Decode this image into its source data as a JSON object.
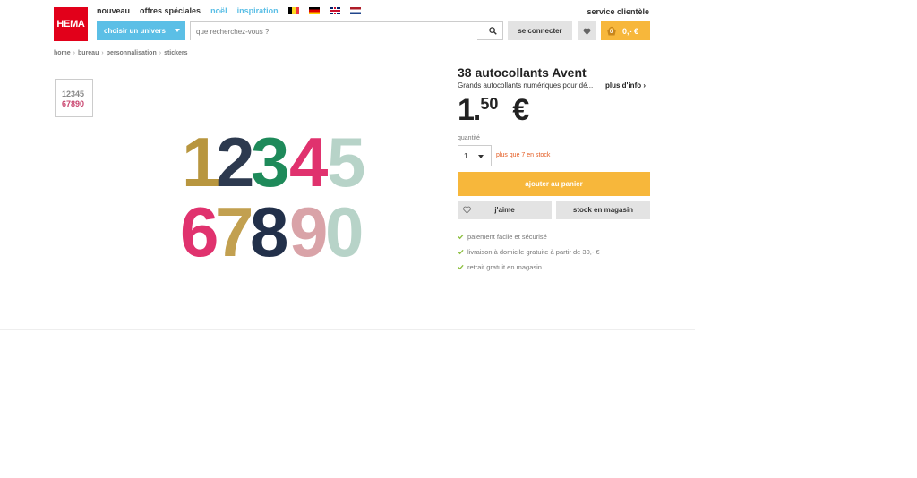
{
  "header": {
    "logo_text": "HEMA",
    "nav": [
      {
        "label": "nouveau"
      },
      {
        "label": "offres spéciales"
      },
      {
        "label": "noël"
      },
      {
        "label": "inspiration"
      }
    ],
    "service_label": "service clientèle",
    "univers_label": "choisir un univers",
    "search_placeholder": "que recherchez-vous ?",
    "connect_label": "se connecter",
    "cart_total": "0,- €",
    "cart_count": "0"
  },
  "breadcrumb": [
    "home",
    "bureau",
    "personnalisation",
    "stickers"
  ],
  "thumbnail": {
    "row1": "12345",
    "row2": "67890"
  },
  "product": {
    "title": "38 autocollants Avent",
    "description": "Grands autocollants numériques pour dé...",
    "more_info": "plus d'info",
    "price_int": "1.",
    "price_dec": "50",
    "currency": "€",
    "quantity_label": "quantité",
    "quantity_value": "1",
    "stock_text": "plus que 7 en stock",
    "add_to_cart": "ajouter au panier",
    "like_label": "j'aime",
    "store_stock_label": "stock en magasin",
    "usps": [
      "paiement facile et sécurisé",
      "livraison à domicile gratuite à partir de 30,- €",
      "retrait gratuit en magasin"
    ]
  },
  "image_digits": {
    "row1": [
      "1",
      "2",
      "3",
      "4",
      "5"
    ],
    "row2": [
      "6",
      "7",
      "8",
      "9",
      "0"
    ]
  },
  "colors": {
    "hema_red": "#e2001a",
    "accent_blue": "#5bbfe6",
    "cta_orange": "#f7b73b",
    "stock_orange": "#e45b21",
    "check_green": "#8cbf3f"
  }
}
